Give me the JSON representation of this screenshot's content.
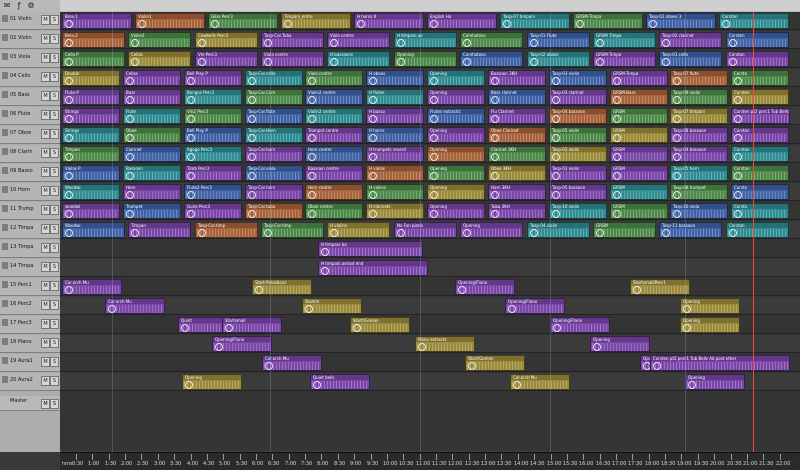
{
  "app": {
    "title": "Multitrack Session"
  },
  "toolbar": {
    "icons": [
      "envelope-icon",
      "fx-icon",
      "settings-icon"
    ]
  },
  "tracks": [
    {
      "name": "01 Violin",
      "m": "M",
      "s": "S"
    },
    {
      "name": "02 Violin",
      "m": "M",
      "s": "S"
    },
    {
      "name": "03 Viola",
      "m": "M",
      "s": "S"
    },
    {
      "name": "04 Cello",
      "m": "M",
      "s": "S"
    },
    {
      "name": "05 Bass",
      "m": "M",
      "s": "S"
    },
    {
      "name": "06 Flute",
      "m": "M",
      "s": "S"
    },
    {
      "name": "07 Oboe",
      "m": "M",
      "s": "S"
    },
    {
      "name": "08 Clarin",
      "m": "M",
      "s": "S"
    },
    {
      "name": "09 Basso",
      "m": "M",
      "s": "S"
    },
    {
      "name": "10 Horn",
      "m": "M",
      "s": "S"
    },
    {
      "name": "11 Trump",
      "m": "M",
      "s": "S"
    },
    {
      "name": "12 Timpa",
      "m": "M",
      "s": "S"
    },
    {
      "name": "13 Timpa",
      "m": "M",
      "s": "S"
    },
    {
      "name": "14 Timpa",
      "m": "M",
      "s": "S"
    },
    {
      "name": "15 Perc1",
      "m": "M",
      "s": "S"
    },
    {
      "name": "16 Perc2",
      "m": "M",
      "s": "S"
    },
    {
      "name": "17 Perc3",
      "m": "M",
      "s": "S"
    },
    {
      "name": "18 Piano",
      "m": "M",
      "s": "S"
    },
    {
      "name": "19 Aura1",
      "m": "M",
      "s": "S"
    },
    {
      "name": "20 Aura2",
      "m": "M",
      "s": "S"
    }
  ],
  "master": {
    "name": "Master",
    "m": "M",
    "s": "S"
  },
  "clips": [
    [
      "Brev.1",
      "Violin1",
      "Gliss Perc3",
      "Timpani_entre",
      "H horns.II",
      "English Ho",
      "Tasp-07 timpani",
      "GRSM-Timpa",
      "Tasp-02 oboes 3",
      "Corstan"
    ],
    [
      "Brev.2",
      "Violin2",
      "Cowbells Perc3",
      "Tasp-Cor.Tuba",
      "Viola centre",
      "H timpani.ae",
      "Comhatoso",
      "Tasp-01 Flute",
      "GRSM Timpa",
      "Tasp-02 clarinet",
      "Corsten"
    ],
    [
      "Cello P",
      "Cellos",
      "Vln-Perc3",
      "Viola centre",
      "H bassoons",
      "Opening",
      "Comhatoso",
      "Tasp-02 oboes",
      "GRSM-Timpa",
      "Tasp-01 cello",
      "Corstan"
    ],
    [
      "Double",
      "Cellos",
      "Bell Play P",
      "Tasp-Cor.cello",
      "Viola centre",
      "H oboes",
      "Opening",
      "Bassoon 3KH",
      "Tasp-03 violin",
      "GRSM-Timpa",
      "Tasp-07 flute",
      "Corsta"
    ],
    [
      "Flute-P",
      "Bass",
      "Bongos Perc3",
      "Tasp-Cor.Corn",
      "Violin2 centre",
      "H flutes",
      "Opening",
      "Bass clarinet",
      "Tasp-03 clarinet",
      "GRSM-Bass",
      "Tasp-09 violin",
      "Corsten"
    ],
    [
      "Strings",
      "Flute",
      "Vln2 Perc3",
      "Tasp-Cor.flute",
      "Violin2 centre",
      "H basso",
      "Flutes extractic",
      "Flu Clarinet",
      "Tasp-04 bassoon",
      "GRSM",
      "Tasp-07 timpani",
      "Corsten pt2 perc1 Tub Bells Ad post ether"
    ],
    [
      "Strings",
      "Oboe",
      "Bell Play P",
      "Tasp-Cor.Horn",
      "Trompet centre",
      "H horns",
      "Opening",
      "Oboe Clarinet",
      "Tasp-05 violin",
      "GRSM",
      "Tasp-08 bassoon",
      "Corstan"
    ],
    [
      "Timpan",
      "Clarinet",
      "Agogo Perc3",
      "Tasp-Cor.horn",
      "Horn centre",
      "H trumpets reverd",
      "Opening",
      "Clarinet 3KH",
      "Tasp-03 violin",
      "GRSM",
      "Tasp-04 bassoon",
      "Corstan"
    ],
    [
      "Violas P",
      "Bassoon",
      "Timb Perc3",
      "Tasp-Cor.viola",
      "Bassoon centre",
      "H violas",
      "Opening",
      "Oboe 3KH",
      "Tasp-03 violin",
      "GRSM",
      "Tasp-05 horn",
      "Corstan"
    ],
    [
      "Woodwi",
      "Horn",
      "Flute2 Perc3",
      "Tasp-Cor.horn",
      "Horn centre",
      "H violins",
      "Opening",
      "Horn 3KH",
      "Tasp-05 bassoon",
      "GRSM",
      "Tasp-08 trumpet",
      "Corsta"
    ],
    [
      "woodwi",
      "Trumpet",
      "Guiro Perc3",
      "Tasp-Cor.tuba",
      "Oboe centre",
      "H clarinets",
      "Opening",
      "Tuba 3KH",
      "Tasp-10 violin",
      "GRSM",
      "Tasp-10 viola",
      "Corsta"
    ],
    [
      "Woodwi",
      "Timpan",
      "Tasp-Cor.timp",
      "Tasp-Cor.timp",
      "H violins",
      "No Fan piano",
      "Opening",
      "Tasp-04 violin",
      "GRSM",
      "Tasp-11 bassoon",
      "Corstan"
    ],
    [
      "H timpani ba"
    ],
    [
      "H timpani.aeriad end"
    ],
    [
      "Cor.orch Mu",
      "Start-Pulsations",
      "Opening/Flano",
      "Startsmall/Perc1"
    ],
    [
      "Cor.orch Mu",
      "Stamm",
      "Opening/Flano",
      "Opening"
    ],
    [
      "Quint",
      "Start/Geman",
      "Opening/Flano",
      "Opening",
      "Startsmall"
    ],
    [
      "Opening/Flano",
      "Piano extracts",
      "Opening"
    ],
    [
      "Cor.orch Mu",
      "Start/Gemen",
      "Opening",
      "Opening",
      "Corsten pt2 perc1 Tub Bells Ad post ether"
    ],
    [
      "Quiet bells",
      "Cor.orch Mu",
      "Opening",
      "Opening"
    ]
  ],
  "colors": {
    "purple": "#7a45a8",
    "orange": "#a8623a",
    "green": "#4d8a4a",
    "teal": "#2f8c92",
    "blue": "#3f61a6",
    "olive": "#9a8a3a",
    "grey": "#6b6b6b"
  },
  "timeline": {
    "labels": [
      "0:30",
      "1:00",
      "1:30",
      "2:00",
      "2:30",
      "3:00",
      "3:30",
      "4:00",
      "4:30",
      "5:00",
      "5:30",
      "6:00",
      "6:30",
      "7:00",
      "7:30",
      "8:00",
      "8:30",
      "9:00",
      "9:30",
      "10:00",
      "10:30",
      "11:00",
      "11:30",
      "12:00",
      "12:30",
      "13:00",
      "13:30",
      "14:00",
      "14:30",
      "15:00",
      "15:30",
      "16:00",
      "16:30",
      "17:00",
      "17:30",
      "18:00",
      "18:30",
      "19:00",
      "19:30",
      "20:00",
      "20:30",
      "21:00",
      "21:30",
      "22:00"
    ],
    "unit": "hms"
  }
}
